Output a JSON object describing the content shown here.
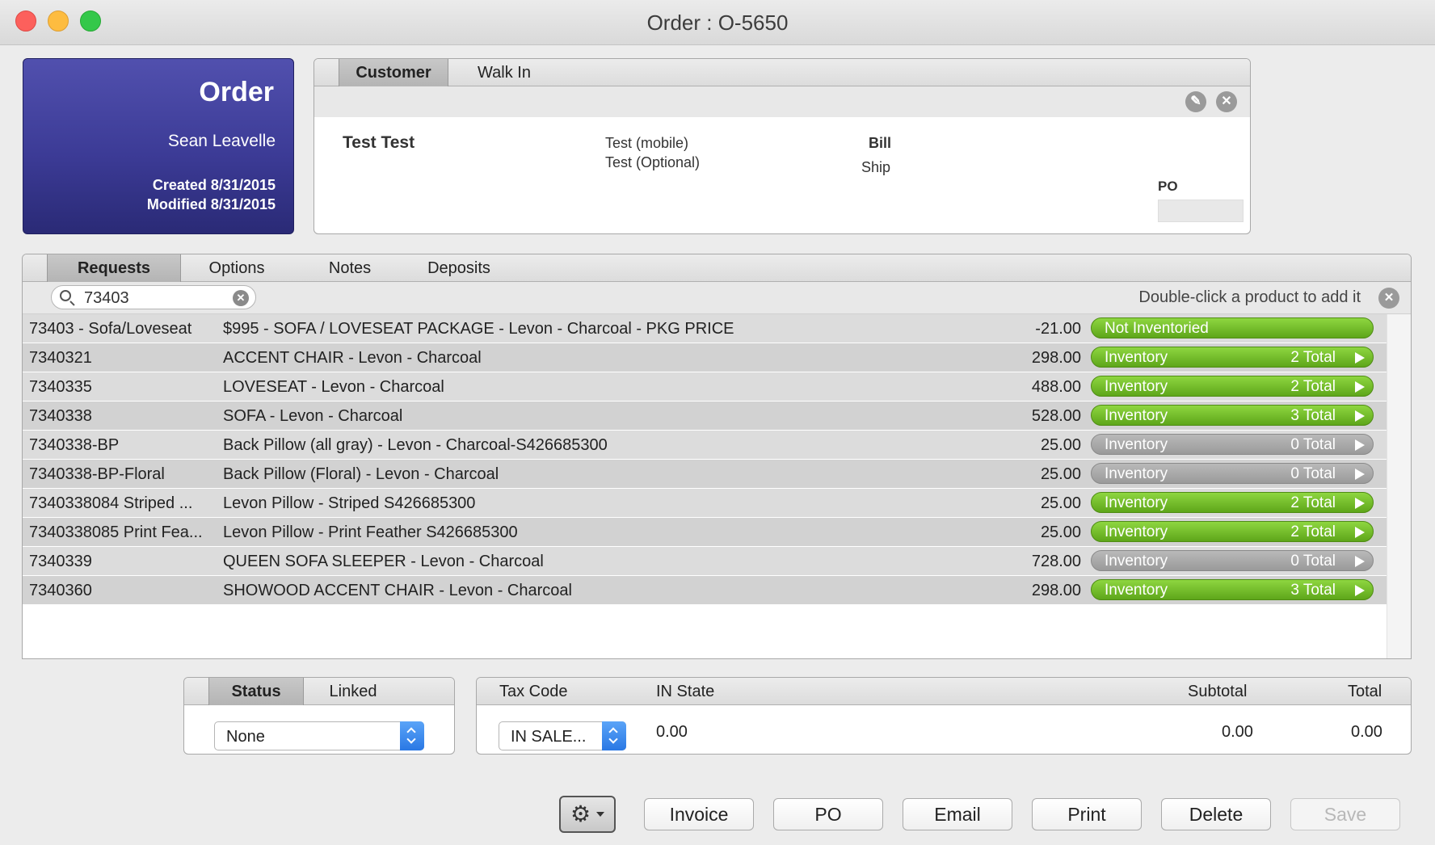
{
  "window": {
    "title": "Order : O-5650"
  },
  "order_card": {
    "title": "Order",
    "salesperson": "Sean Leavelle",
    "created": "Created 8/31/2015",
    "modified": "Modified 8/31/2015"
  },
  "customer": {
    "tabs": [
      "Customer",
      "Walk In"
    ],
    "name": "Test Test",
    "phone_mobile": "Test (mobile)",
    "phone_optional": "Test (Optional)",
    "bill_label": "Bill",
    "ship_label": "Ship",
    "po_label": "PO",
    "po_value": ""
  },
  "requests": {
    "tabs": [
      "Requests",
      "Options",
      "Notes",
      "Deposits"
    ],
    "search_value": "73403",
    "hint": "Double-click a product to add it",
    "rows": [
      {
        "sku": "73403 - Sofa/Loveseat",
        "desc": "$995 - SOFA / LOVESEAT PACKAGE - Levon - Charcoal - PKG PRICE",
        "price": "-21.00",
        "status": "Not Inventoried",
        "count": "",
        "color": "green"
      },
      {
        "sku": "7340321",
        "desc": "ACCENT CHAIR -  Levon - Charcoal",
        "price": "298.00",
        "status": "Inventory",
        "count": "2 Total",
        "color": "green"
      },
      {
        "sku": "7340335",
        "desc": "LOVESEAT -  Levon - Charcoal",
        "price": "488.00",
        "status": "Inventory",
        "count": "2 Total",
        "color": "green"
      },
      {
        "sku": "7340338",
        "desc": "SOFA -  Levon - Charcoal",
        "price": "528.00",
        "status": "Inventory",
        "count": "3 Total",
        "color": "green"
      },
      {
        "sku": "7340338-BP",
        "desc": "Back Pillow (all gray) - Levon - Charcoal-S426685300",
        "price": "25.00",
        "status": "Inventory",
        "count": "0 Total",
        "color": "gray"
      },
      {
        "sku": "7340338-BP-Floral",
        "desc": "Back Pillow (Floral) - Levon - Charcoal",
        "price": "25.00",
        "status": "Inventory",
        "count": "0 Total",
        "color": "gray"
      },
      {
        "sku": "7340338084 Striped ...",
        "desc": "Levon Pillow - Striped S426685300",
        "price": "25.00",
        "status": "Inventory",
        "count": "2 Total",
        "color": "green"
      },
      {
        "sku": "7340338085 Print Fea...",
        "desc": "Levon Pillow - Print Feather S426685300",
        "price": "25.00",
        "status": "Inventory",
        "count": "2 Total",
        "color": "green"
      },
      {
        "sku": "7340339",
        "desc": "QUEEN SOFA SLEEPER -  Levon - Charcoal",
        "price": "728.00",
        "status": "Inventory",
        "count": "0 Total",
        "color": "gray"
      },
      {
        "sku": "7340360",
        "desc": "SHOWOOD ACCENT CHAIR -  Levon - Charcoal",
        "price": "298.00",
        "status": "Inventory",
        "count": "3 Total",
        "color": "green"
      }
    ]
  },
  "status_panel": {
    "tabs": [
      "Status",
      "Linked"
    ],
    "selected": "None"
  },
  "totals": {
    "tax_code_label": "Tax Code",
    "tax_code_value": "IN SALE...",
    "state_label": "IN State",
    "state_value": "0.00",
    "subtotal_label": "Subtotal",
    "subtotal_value": "0.00",
    "total_label": "Total",
    "total_value": "0.00"
  },
  "footer": {
    "buttons": [
      "Invoice",
      "PO",
      "Email",
      "Print",
      "Delete",
      "Save"
    ]
  },
  "colors": {
    "order_card": "#3c3b96",
    "pill_green": "#6cb524",
    "pill_gray": "#a5a5a5",
    "select_blue": "#3a86ee"
  }
}
